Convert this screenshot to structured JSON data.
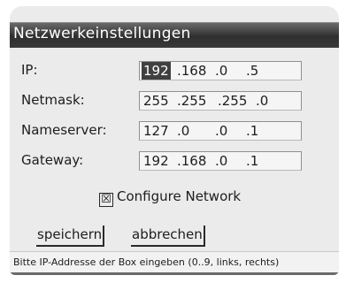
{
  "window": {
    "title": "Netzwerkeinstellungen"
  },
  "form": {
    "rows": [
      {
        "label": "IP:",
        "octets": [
          "192",
          ".168",
          ".0",
          ".5"
        ],
        "selected": 0
      },
      {
        "label": "Netmask:",
        "octets": [
          "255",
          ".255",
          ".255",
          ".0"
        ],
        "selected": -1
      },
      {
        "label": "Nameserver:",
        "octets": [
          "127",
          ".0",
          ".0",
          ".1"
        ],
        "selected": -1
      },
      {
        "label": "Gateway:",
        "octets": [
          "192",
          ".168",
          ".0",
          ".1"
        ],
        "selected": -1
      }
    ],
    "configure_network": {
      "label": "Configure Network",
      "checked": true,
      "check_glyph": "☒"
    }
  },
  "buttons": {
    "save": "speichern",
    "cancel": "abbrechen"
  },
  "statusbar": {
    "text": "Bitte IP-Addresse der Box eingeben (0..9, links, rechts)"
  },
  "colors": {
    "titlebar": "#3a3a3a",
    "selected_octet": "#404040",
    "panel": "#ebebeb"
  }
}
